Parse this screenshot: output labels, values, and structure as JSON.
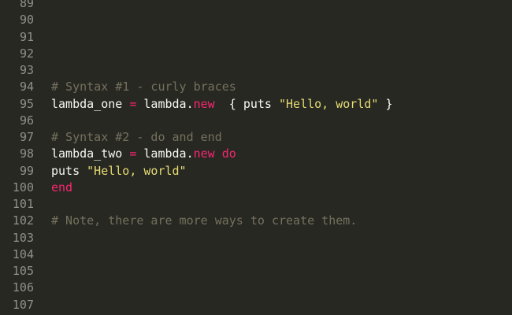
{
  "editor": {
    "lines": [
      {
        "number": "89",
        "tokens": []
      },
      {
        "number": "90",
        "tokens": []
      },
      {
        "number": "91",
        "tokens": []
      },
      {
        "number": "92",
        "tokens": []
      },
      {
        "number": "93",
        "tokens": []
      },
      {
        "number": "94",
        "tokens": [
          {
            "type": "comment",
            "text": "# Syntax #1 - curly braces"
          }
        ]
      },
      {
        "number": "95",
        "tokens": [
          {
            "type": "plain",
            "text": "lambda_one "
          },
          {
            "type": "keyword",
            "text": "="
          },
          {
            "type": "plain",
            "text": " lambda."
          },
          {
            "type": "keyword",
            "text": "new"
          },
          {
            "type": "plain",
            "text": "  { puts "
          },
          {
            "type": "string",
            "text": "\"Hello, world\""
          },
          {
            "type": "plain",
            "text": " }"
          }
        ]
      },
      {
        "number": "96",
        "tokens": []
      },
      {
        "number": "97",
        "tokens": [
          {
            "type": "comment",
            "text": "# Syntax #2 - do and end"
          }
        ]
      },
      {
        "number": "98",
        "tokens": [
          {
            "type": "plain",
            "text": "lambda_two "
          },
          {
            "type": "keyword",
            "text": "="
          },
          {
            "type": "plain",
            "text": " lambda."
          },
          {
            "type": "keyword",
            "text": "new do"
          }
        ]
      },
      {
        "number": "99",
        "tokens": [
          {
            "type": "plain",
            "text": "puts "
          },
          {
            "type": "string",
            "text": "\"Hello, world\""
          }
        ]
      },
      {
        "number": "100",
        "tokens": [
          {
            "type": "keyword",
            "text": "end"
          }
        ]
      },
      {
        "number": "101",
        "tokens": []
      },
      {
        "number": "102",
        "tokens": [
          {
            "type": "comment",
            "text": "# Note, there are more ways to create them."
          }
        ]
      },
      {
        "number": "103",
        "tokens": []
      },
      {
        "number": "104",
        "tokens": []
      },
      {
        "number": "105",
        "tokens": []
      },
      {
        "number": "106",
        "tokens": []
      },
      {
        "number": "107",
        "tokens": []
      }
    ]
  },
  "colors": {
    "background": "#272822",
    "gutter_text": "#8f908a",
    "plain": "#f8f8f2",
    "comment": "#75715e",
    "keyword": "#f92672",
    "string": "#e6db74"
  }
}
